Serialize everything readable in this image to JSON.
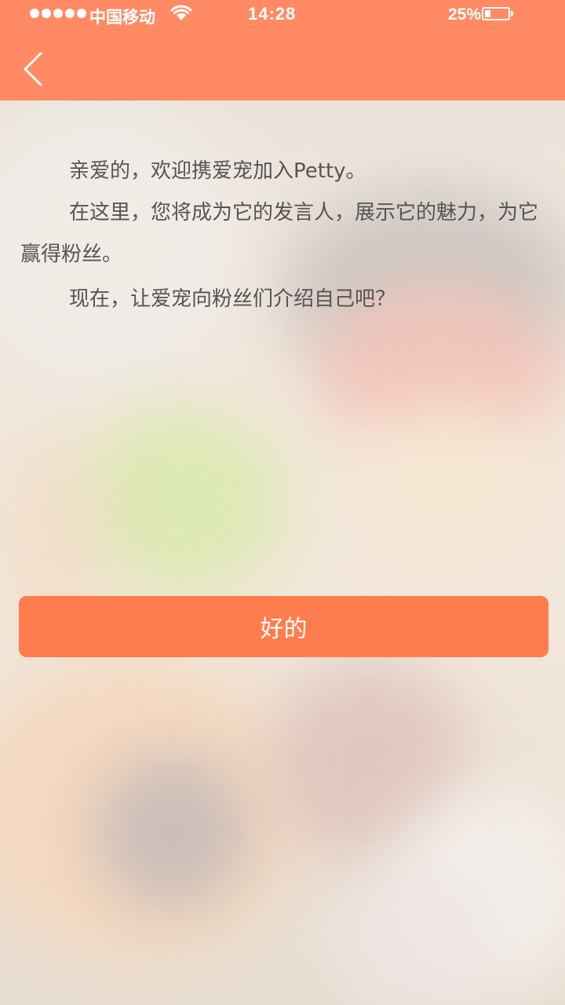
{
  "status_bar": {
    "carrier": "中国移动",
    "time": "14:28",
    "battery_percent": "25%",
    "battery_level": 0.25,
    "wifi_icon": "wifi-icon",
    "signal_icon": "signal-dots-icon"
  },
  "header": {
    "back_icon": "chevron-left-icon",
    "background_color": "#ff8a64"
  },
  "message": {
    "line1": "亲爱的，欢迎携爱宠加入Petty。",
    "line2": "在这里，您将成为它的发言人，展示它的魅力，为它赢得粉丝。",
    "line3": "现在，让爱宠向粉丝们介绍自己吧？"
  },
  "actions": {
    "ok_label": "好的",
    "button_color": "#ff7c4f"
  }
}
